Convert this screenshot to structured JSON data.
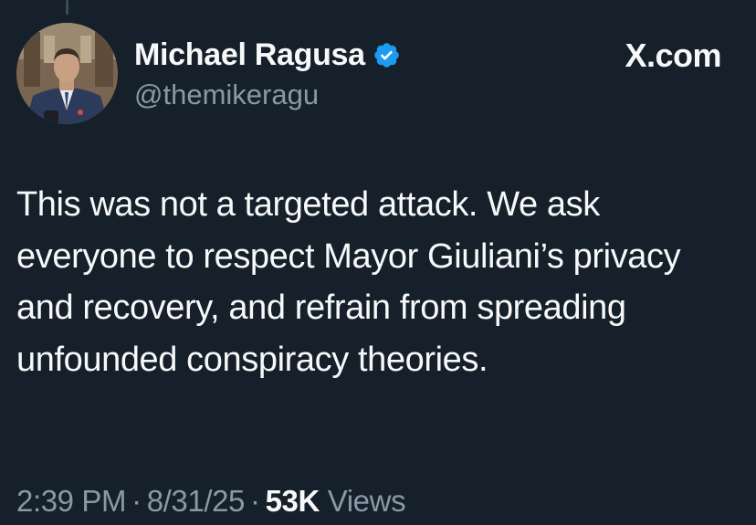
{
  "tweet": {
    "author": {
      "display_name": "Michael Ragusa",
      "handle": "@themikeragu",
      "verified": true,
      "verified_icon": "verified-badge-icon",
      "avatar_icon": "profile-photo"
    },
    "site_brand": "X.com",
    "text": "This was not a targeted attack. We ask everyone to respect Mayor Giuliani’s privacy and recovery, and refrain from spreading unfounded conspiracy theories.",
    "meta": {
      "time": "2:39 PM",
      "separator": "·",
      "date": "8/31/25",
      "views_count": "53K",
      "views_label": "Views"
    }
  },
  "colors": {
    "background": "#15202b",
    "primary_text": "#f7f9f9",
    "secondary_text": "#8b98a5",
    "verified_blue": "#1d9bf0"
  }
}
